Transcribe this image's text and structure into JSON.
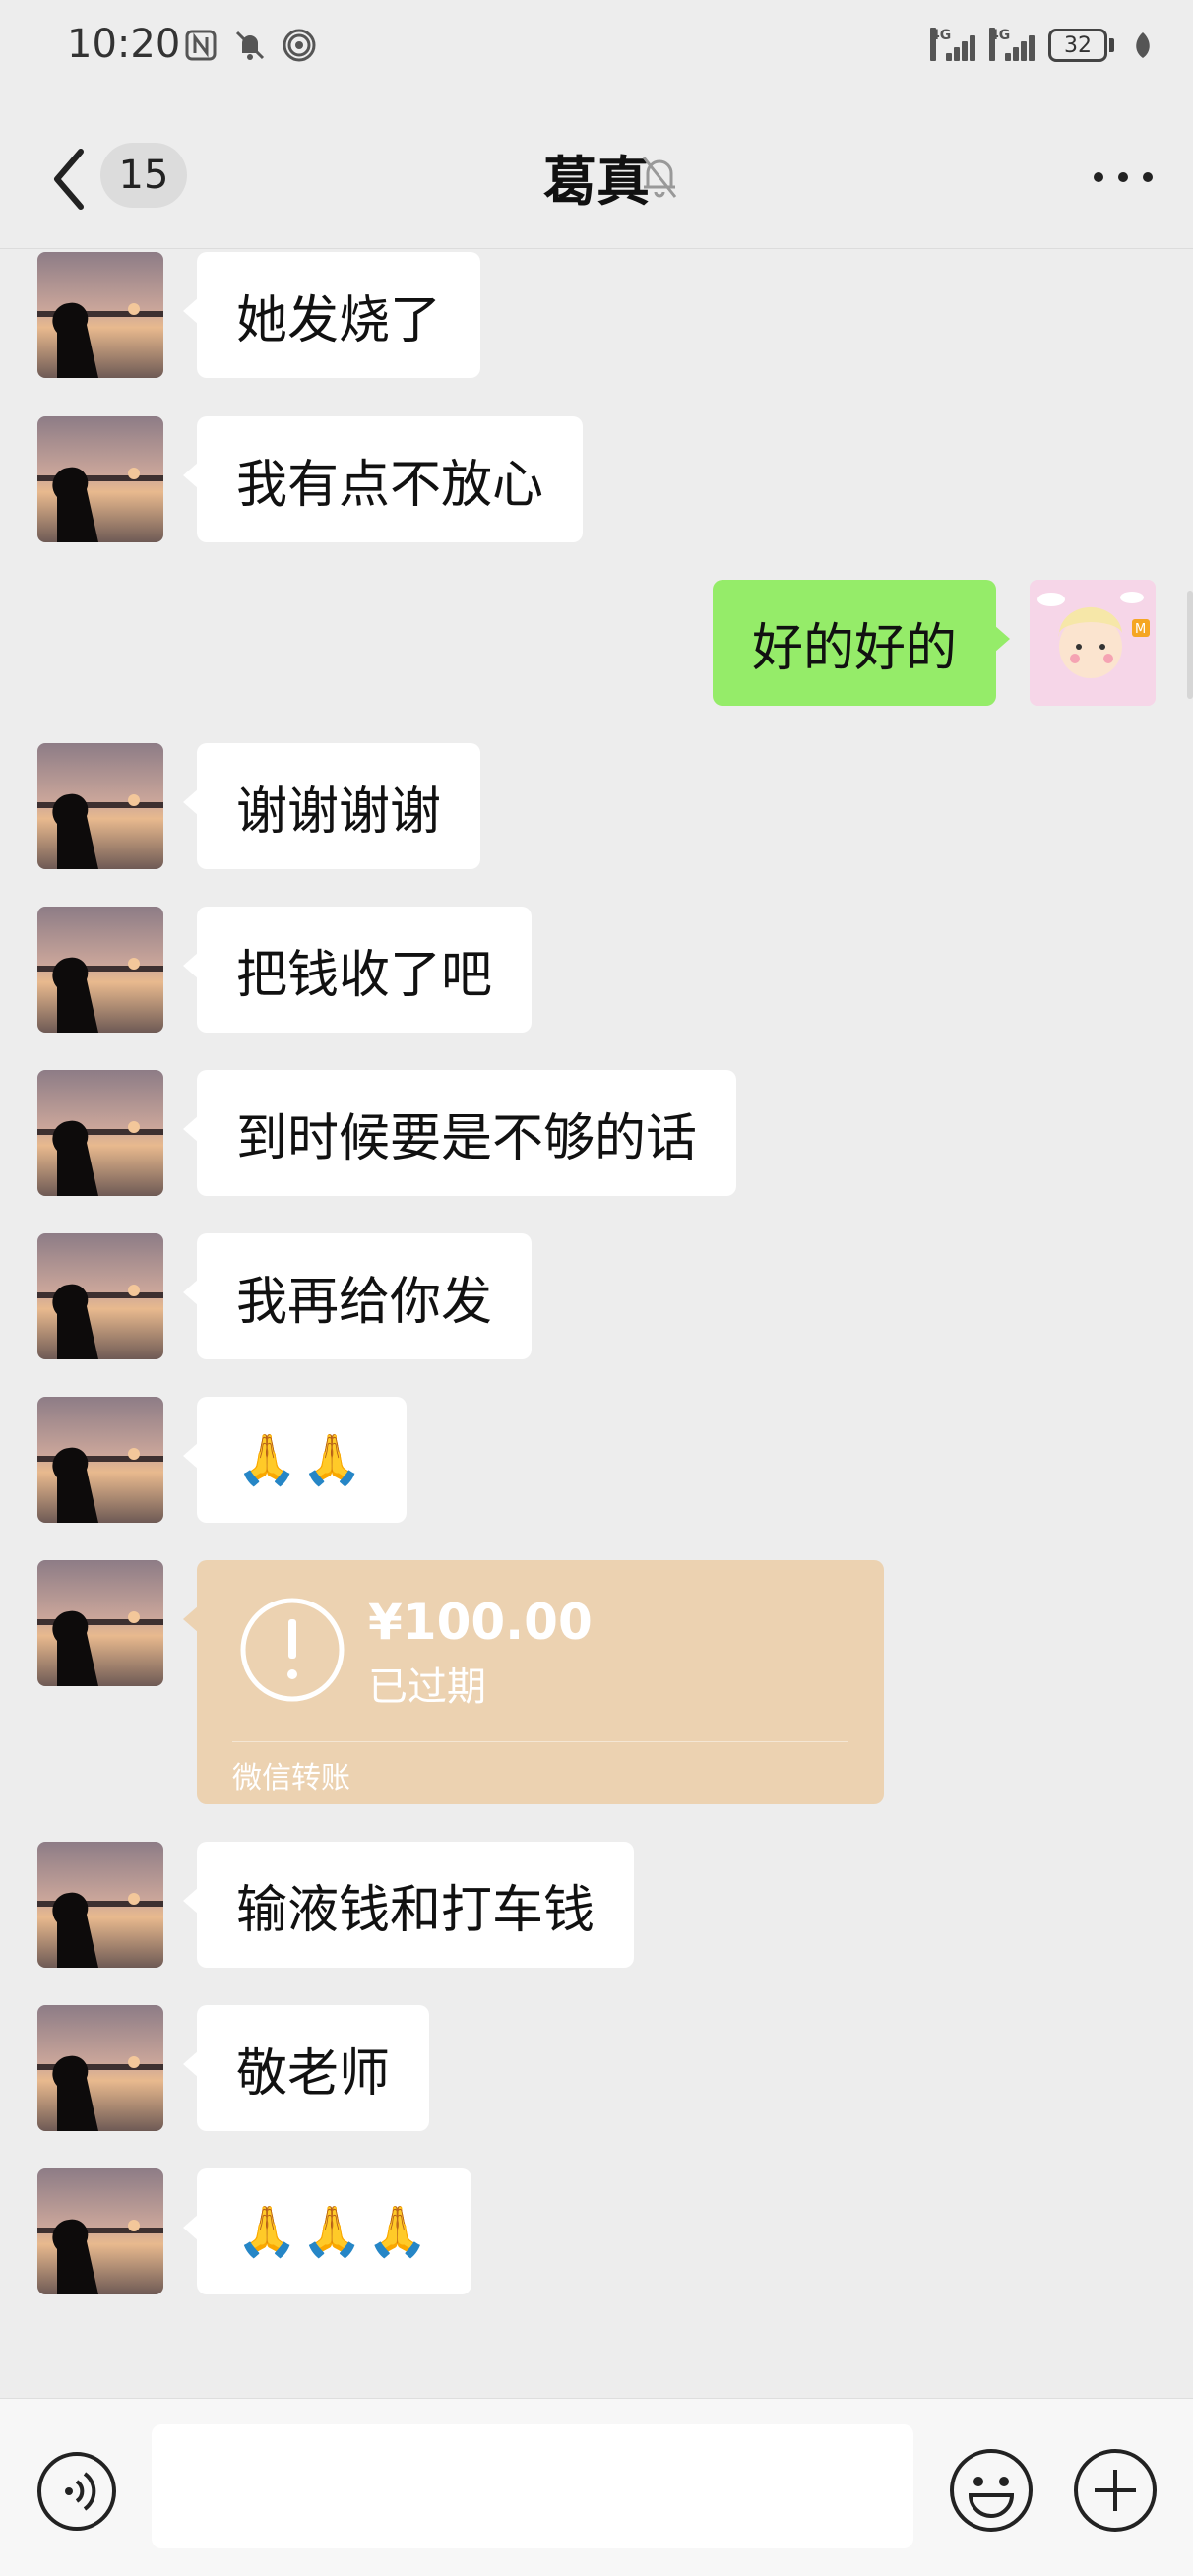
{
  "status_bar": {
    "time": "10:20",
    "battery": "32"
  },
  "header": {
    "unread_count": "15",
    "title": "葛真"
  },
  "messages": [
    {
      "side": "left",
      "text": "她发烧了"
    },
    {
      "side": "left",
      "text": "我有点不放心"
    },
    {
      "side": "right",
      "text": "好的好的"
    },
    {
      "side": "left",
      "text": "谢谢谢谢"
    },
    {
      "side": "left",
      "text": "把钱收了吧"
    },
    {
      "side": "left",
      "text": "到时候要是不够的话"
    },
    {
      "side": "left",
      "text": "我再给你发"
    },
    {
      "side": "left",
      "text": "🙏🙏"
    },
    {
      "side": "left",
      "type": "transfer",
      "amount": "¥100.00",
      "status": "已过期",
      "label": "微信转账"
    },
    {
      "side": "left",
      "text": "输液钱和打车钱"
    },
    {
      "side": "left",
      "text": "敬老师"
    },
    {
      "side": "left",
      "text": "🙏🙏🙏"
    }
  ],
  "colors": {
    "background": "#ededed",
    "my_bubble": "#95ec69",
    "their_bubble": "#ffffff",
    "transfer_expired": "#ecd2b1"
  },
  "icons": [
    "back-arrow-icon",
    "mute-bell-icon",
    "more-dots-icon",
    "voice-icon",
    "emoji-icon",
    "plus-icon"
  ]
}
